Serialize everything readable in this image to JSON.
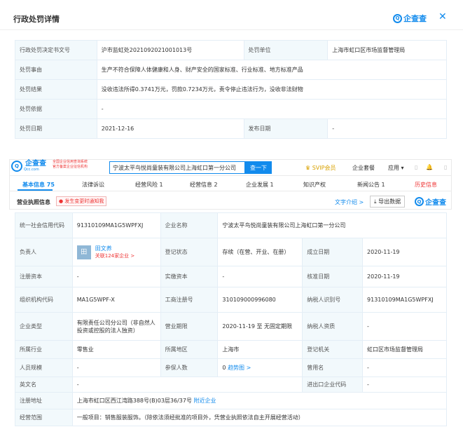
{
  "panel_top": {
    "title": "行政处罚详情",
    "logo_text": "企查查",
    "logo_mark": "Q",
    "close": "✕",
    "rows": [
      {
        "k1": "行政处罚决定书文号",
        "v1": "沪市监虹处2021092021001013号",
        "k2": "处罚单位",
        "v2": "上海市虹口区市场监督管理局"
      },
      {
        "k1": "处罚事由",
        "v1": "生产不符合保障人体健康和人身、财产安全的国家标准、行业标准、地方标准产品"
      },
      {
        "k1": "处罚结果",
        "v1": "没收违法所得0.3741万元，罚款0.7234万元，责令停止违法行为，没收非法财物"
      },
      {
        "k1": "处罚依据",
        "v1": "-"
      },
      {
        "k1": "处罚日期",
        "v1": "2021-12-16",
        "k2": "发布日期",
        "v2": "-"
      }
    ]
  },
  "header": {
    "logo_mark": "Q",
    "logo_text": "企查查",
    "logo_url": "Qcc.com",
    "slogan_1": "全国企业信用查询系统",
    "slogan_2": "官方备案企业征信机构",
    "search_value": "宁波太平鸟悦尚童装有限公司上海虹口第一分公司",
    "search_button": "查一下",
    "svip": "SVIP会员",
    "nav": [
      "企业套餐",
      "应用 ▾",
      "▯",
      "🔔",
      "▯"
    ]
  },
  "tabs": [
    {
      "label": "基本信息 75"
    },
    {
      "label": "法律诉讼"
    },
    {
      "label": "经营风险 1"
    },
    {
      "label": "经营信息 2"
    },
    {
      "label": "企业发展 1"
    },
    {
      "label": "知识产权"
    },
    {
      "label": "新闻公告 1"
    },
    {
      "label": "历史信息"
    }
  ],
  "subheader": {
    "title": "营业执照信息",
    "badge": "发生变更时通知我",
    "link": "文字介绍 >",
    "export": "导出数据",
    "logo_text": "企查查"
  },
  "info": {
    "r1": {
      "k1": "统一社会信用代码",
      "v1": "91310109MA1G5WPFXJ",
      "k2": "企业名称",
      "v2": "宁波太平鸟悦尚童装有限公司上海虹口第一分公司"
    },
    "r2": {
      "k1": "负责人",
      "avatar": "田",
      "person": "田文养",
      "related": "关联124家企业 >",
      "k2": "登记状态",
      "v2": "存续（在营、开业、在册）",
      "k3": "成立日期",
      "v3": "2020-11-19"
    },
    "r3": {
      "k1": "注册资本",
      "v1": "-",
      "k2": "实缴资本",
      "v2": "-",
      "k3": "核准日期",
      "v3": "2020-11-19"
    },
    "r4": {
      "k1": "组织机构代码",
      "v1": "MA1G5WPF-X",
      "k2": "工商注册号",
      "v2": "310109000996080",
      "k3": "纳税人识别号",
      "v3": "91310109MA1G5WPFXJ"
    },
    "r5": {
      "k1": "企业类型",
      "v1": "有限责任公司分公司（非自然人投资或控股的法人独资）",
      "k2": "营业期限",
      "v2": "2020-11-19 至 无固定期限",
      "k3": "纳税人资质",
      "v3": "-"
    },
    "r6": {
      "k1": "所属行业",
      "v1": "零售业",
      "k2": "所属地区",
      "v2": "上海市",
      "k3": "登记机关",
      "v3": "虹口区市场监督管理局"
    },
    "r7": {
      "k1": "人员规模",
      "v1": "-",
      "k2": "参保人数",
      "v2": "0",
      "v2_link": "趋势图 >",
      "k3": "曾用名",
      "v3": "-"
    },
    "r8": {
      "k1": "英文名",
      "v1": "-",
      "k3": "进出口企业代码",
      "v3": "-"
    },
    "r9": {
      "k1": "注册地址",
      "v1": "上海市虹口区西江湾路388号(B)03层36/37号",
      "link": "附近企业"
    },
    "r10": {
      "k1": "经营范围",
      "v1": "一般项目：销售服装服饰。（除依法须经批准的项目外，凭营业执照依法自主开展经营活动）"
    }
  }
}
